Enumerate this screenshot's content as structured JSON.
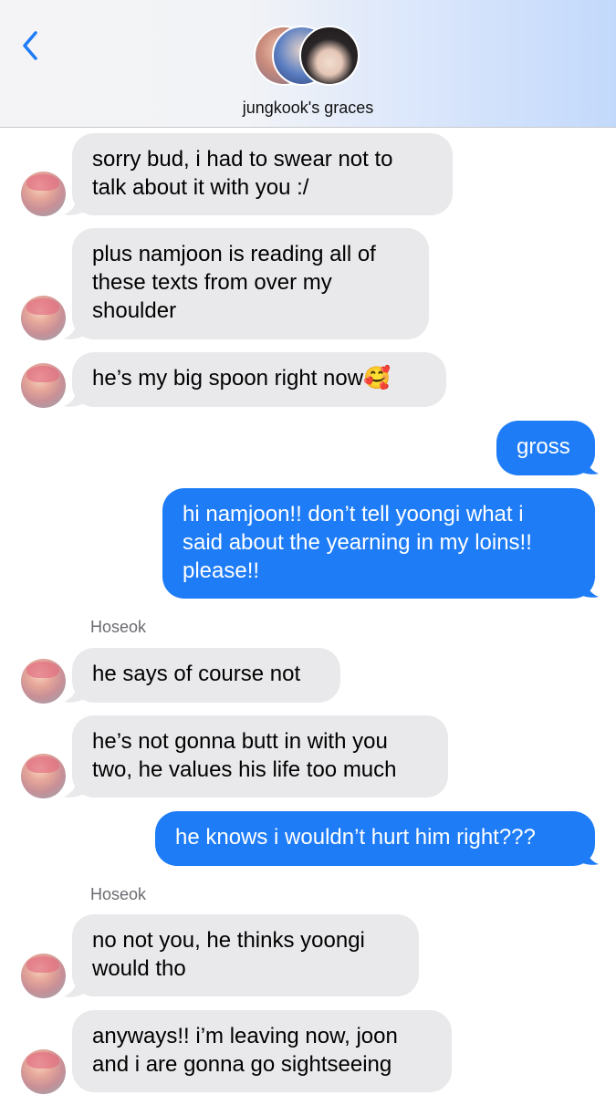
{
  "header": {
    "group_name": "jungkook's graces"
  },
  "icons": {
    "back": "chevron-left-icon"
  },
  "colors": {
    "incoming_bubble": "#e9e9eb",
    "outgoing_bubble": "#1e7cf6",
    "back_chevron": "#1e7cf6"
  },
  "messages": [
    {
      "direction": "in",
      "lines": [
        "sorry bud, i had to swear not to",
        "talk about it with you :/"
      ]
    },
    {
      "direction": "in",
      "lines": [
        "plus namjoon is reading all of",
        "these texts from over my",
        "shoulder"
      ]
    },
    {
      "direction": "in",
      "lines": [
        "he’s my big spoon right now🥰"
      ]
    },
    {
      "direction": "out",
      "lines": [
        "gross"
      ]
    },
    {
      "direction": "out",
      "lines": [
        "hi namjoon!! don’t tell yoongi what i",
        "said about the yearning in my loins!!",
        "please!!"
      ]
    },
    {
      "direction": "in",
      "sender": "Hoseok",
      "lines": [
        "he says of course not"
      ]
    },
    {
      "direction": "in",
      "lines": [
        "he’s not gonna butt in with you",
        "two, he values his life too much"
      ]
    },
    {
      "direction": "out",
      "lines": [
        "he knows i wouldn’t hurt him right???"
      ]
    },
    {
      "direction": "in",
      "sender": "Hoseok",
      "lines": [
        "no not you, he thinks yoongi",
        "would tho"
      ]
    },
    {
      "direction": "in",
      "lines": [
        "anyways!! i’m leaving now, joon",
        "and i are gonna go sightseeing"
      ]
    }
  ]
}
